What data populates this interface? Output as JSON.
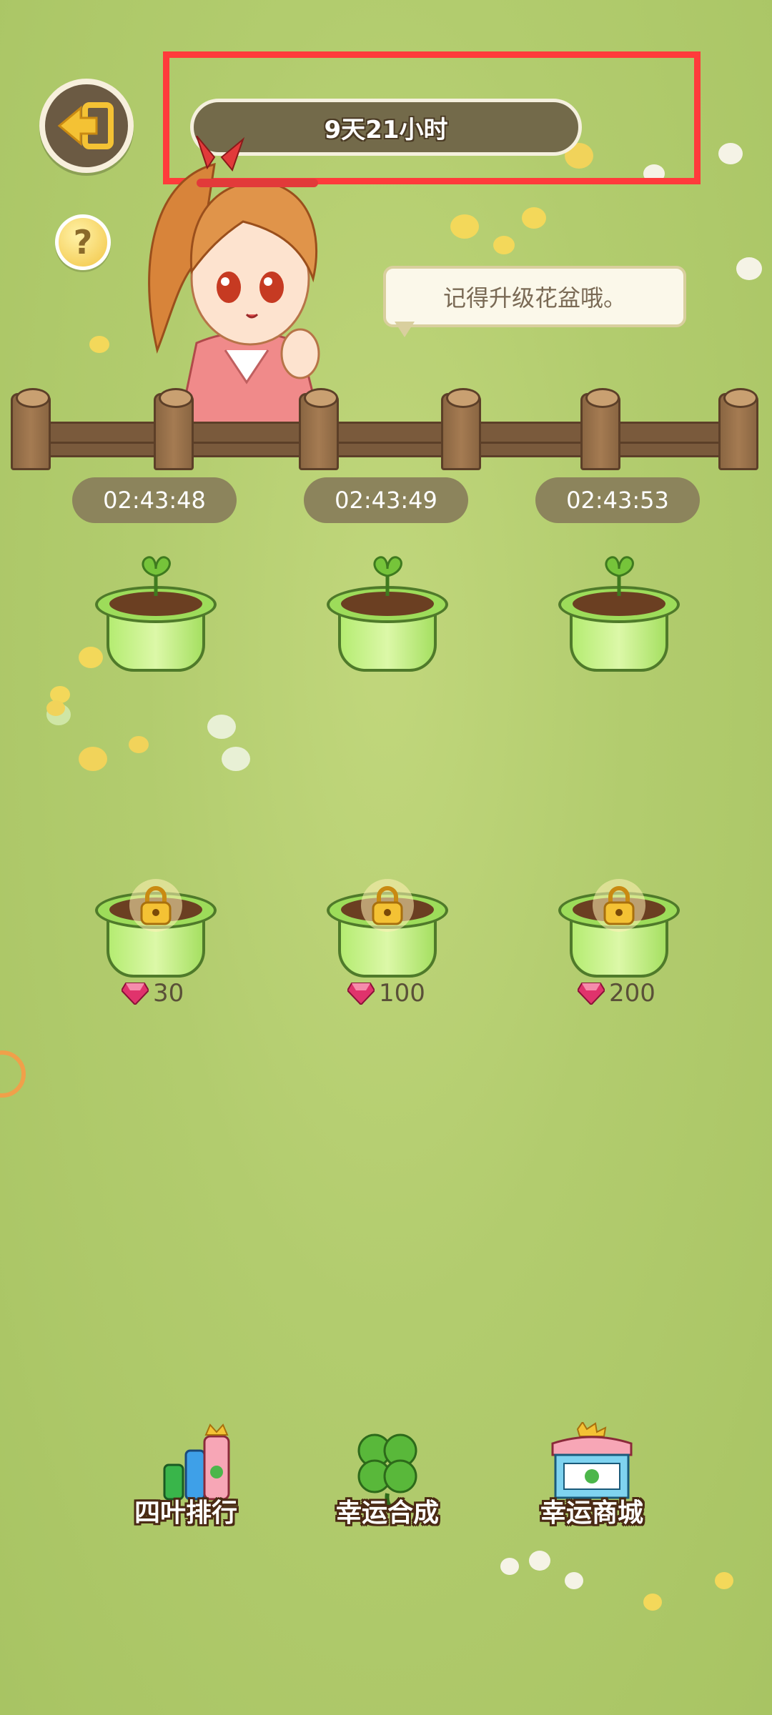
{
  "header": {
    "event_countdown": "9天21小时"
  },
  "character": {
    "speech": "记得升级花盆哦。"
  },
  "pots": {
    "planted": [
      {
        "timer": "02:43:48"
      },
      {
        "timer": "02:43:49"
      },
      {
        "timer": "02:43:53"
      }
    ],
    "locked": [
      {
        "price": "30"
      },
      {
        "price": "100"
      },
      {
        "price": "200"
      }
    ]
  },
  "menu": {
    "ranking_label": "四叶排行",
    "synthesis_label": "幸运合成",
    "shop_label": "幸运商城"
  },
  "icons": [
    "back-icon",
    "help-icon",
    "sprout-icon",
    "lock-icon",
    "gem-icon",
    "ranking-icon",
    "clover-icon",
    "shop-icon"
  ],
  "colors": {
    "highlight": "#ff3b3b",
    "pot_green": "#9ddc5a",
    "gem": "#e0336c"
  }
}
